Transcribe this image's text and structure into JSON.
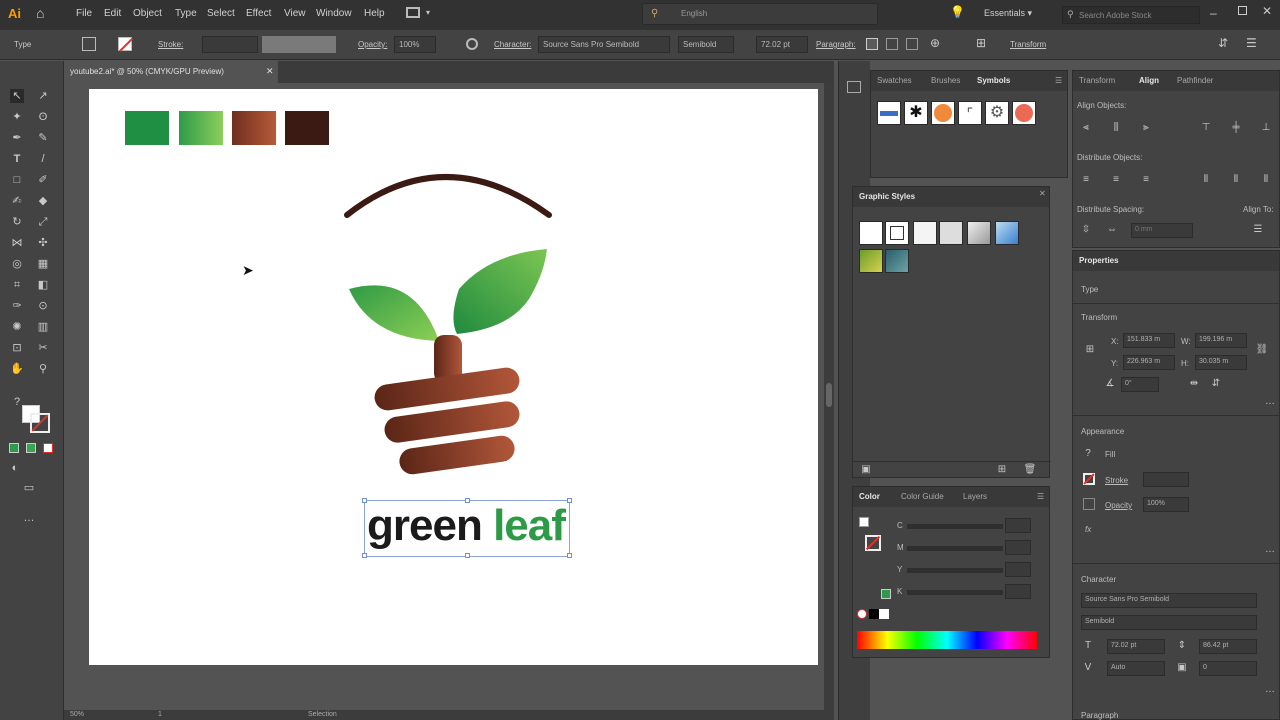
{
  "menubar": {
    "logo": "Ai",
    "items": [
      "File",
      "Edit",
      "Object",
      "Type",
      "Select",
      "Effect",
      "View",
      "Window",
      "Help"
    ],
    "workspace": "Essentials",
    "search_placeholder": "Search Adobe Stock",
    "center_search": "English"
  },
  "control": {
    "type_label": "Type",
    "stroke_label": "Stroke:",
    "opacity_label": "Opacity:",
    "opacity_value": "100%",
    "character_label": "Character:",
    "font_family": "Source Sans Pro Semibold",
    "font_style": "Semibold",
    "font_size": "72.02 pt",
    "paragraph_label": "Paragraph:",
    "transform_label": "Transform"
  },
  "document": {
    "tab_title": "youtube2.ai* @ 50% (CMYK/GPU Preview)",
    "logo_text_part1": "green",
    "logo_text_part2": "leaf",
    "swatch_colors": [
      "#1e8f43",
      "#6ab94a",
      "#8e4a2e",
      "#3a1a12"
    ],
    "status_zoom": "50%",
    "status_page": "1",
    "status_tool": "Selection"
  },
  "panels": {
    "swatches_tabs": [
      "Swatches",
      "Brushes",
      "Symbols"
    ],
    "graphic_styles_title": "Graphic Styles",
    "color_tabs": [
      "Color",
      "Color Guide",
      "Layers"
    ],
    "color_channels": [
      "C",
      "M",
      "Y",
      "K"
    ],
    "align": {
      "tabs": [
        "Transform",
        "Align",
        "Pathfinder"
      ],
      "align_objects": "Align Objects:",
      "distribute_objects": "Distribute Objects:",
      "distribute_spacing": "Distribute Spacing:",
      "align_to": "Align To:",
      "spacing_value": "0 mm"
    },
    "properties": {
      "title": "Properties",
      "type": "Type",
      "transform": "Transform",
      "x": "151.833 m",
      "y": "226.963 m",
      "w": "199.196 m",
      "h": "30.035 m",
      "angle": "0°",
      "appearance": "Appearance",
      "fill": "Fill",
      "stroke": "Stroke",
      "opacity": "Opacity",
      "opacity_value": "100%",
      "fx": "fx",
      "character": "Character",
      "font_family": "Source Sans Pro Semibold",
      "font_style": "Semibold",
      "font_size": "72.02 pt",
      "leading": "86.42 pt",
      "kerning": "Auto",
      "tracking": "0",
      "paragraph": "Paragraph"
    }
  }
}
